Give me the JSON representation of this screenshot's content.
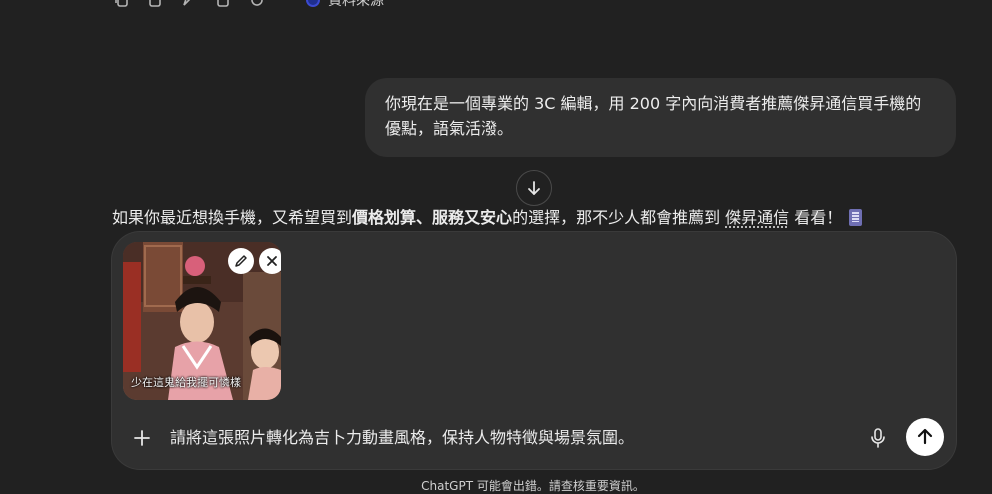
{
  "top_actions": {
    "icons": [
      "copy-icon",
      "share-icon",
      "edit-icon",
      "bookmark-icon",
      "regenerate-icon"
    ],
    "sources_label": "資料來源"
  },
  "conversation": {
    "user_message": "你現在是一個專業的 3C 編輯，用 200 字內向消費者推薦傑昇通信買手機的優點，語氣活潑。",
    "assistant": {
      "part1": "如果你最近想換手機，又希望買到",
      "bold1": "價格划算",
      "sep": "、",
      "bold2": "服務又安心",
      "part2": "的選擇，那不少人都會推薦到 ",
      "link": "傑昇通信",
      "part3": " 看看！"
    }
  },
  "composer": {
    "attachment_caption": "少在這鬼給我擺可憐樣",
    "prompt": "請將這張照片轉化為吉卜力動畫風格，保持人物特徵與場景氛圍。"
  },
  "footer": {
    "disclaimer": "ChatGPT 可能會出錯。請查核重要資訊。"
  },
  "colors": {
    "background": "#212121",
    "bubble": "#303030",
    "text": "#ececec",
    "send_button": "#ffffff"
  }
}
